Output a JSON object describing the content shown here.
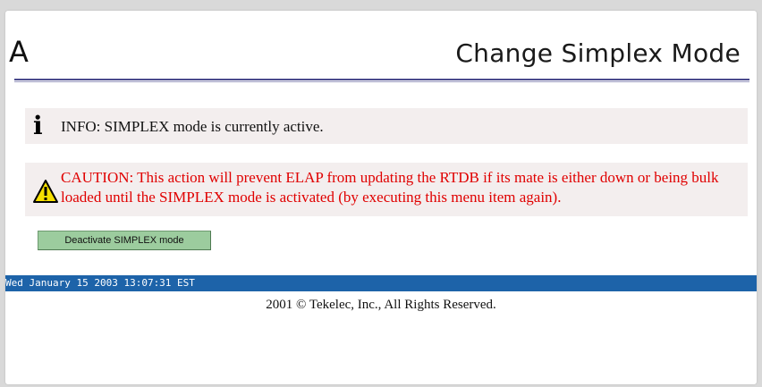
{
  "header": {
    "app_letter": "A",
    "title": "Change Simplex Mode"
  },
  "info": {
    "icon": "info-icon",
    "text": "INFO: SIMPLEX mode is currently active."
  },
  "caution": {
    "icon": "warning-triangle-icon",
    "line1": "CAUTION: This action will prevent ELAP from updating the RTDB if its mate is either down or being bulk",
    "line2": "loaded until the SIMPLEX mode is activated (by executing this menu item again).",
    "color": "#e00000"
  },
  "action": {
    "button_label": "Deactivate SIMPLEX mode",
    "color": "#9ccc9e"
  },
  "status_bar": {
    "timestamp": "Wed January 15 2003 13:07:31 EST",
    "color": "#1d63a9"
  },
  "footer": {
    "copyright": "2001 © Tekelec, Inc., All Rights Reserved."
  }
}
